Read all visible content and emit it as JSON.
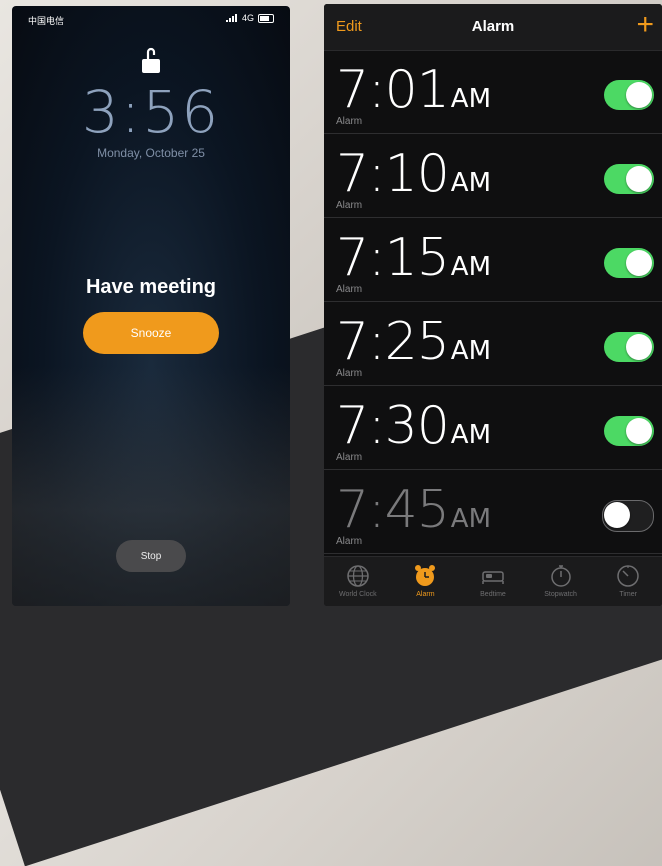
{
  "lock_screen": {
    "carrier": "中国电信",
    "network": "4G",
    "time": "3:56",
    "date": "Monday, October 25",
    "alarm_label": "Have meeting",
    "snooze_label": "Snooze",
    "stop_label": "Stop"
  },
  "alarm_app": {
    "edit_label": "Edit",
    "title": "Alarm",
    "add_label": "+",
    "accent": "#f09a1c",
    "toggle_on_color": "#4cd964",
    "alarms": [
      {
        "time": "7:01",
        "ampm": "AM",
        "label": "Alarm",
        "enabled": true
      },
      {
        "time": "7:10",
        "ampm": "AM",
        "label": "Alarm",
        "enabled": true
      },
      {
        "time": "7:15",
        "ampm": "AM",
        "label": "Alarm",
        "enabled": true
      },
      {
        "time": "7:25",
        "ampm": "AM",
        "label": "Alarm",
        "enabled": true
      },
      {
        "time": "7:30",
        "ampm": "AM",
        "label": "Alarm",
        "enabled": true
      },
      {
        "time": "7:45",
        "ampm": "AM",
        "label": "Alarm",
        "enabled": false
      }
    ],
    "tabs": [
      {
        "label": "World Clock",
        "icon": "globe-icon",
        "active": false
      },
      {
        "label": "Alarm",
        "icon": "alarm-clock-icon",
        "active": true
      },
      {
        "label": "Bedtime",
        "icon": "bed-icon",
        "active": false
      },
      {
        "label": "Stopwatch",
        "icon": "stopwatch-icon",
        "active": false
      },
      {
        "label": "Timer",
        "icon": "timer-icon",
        "active": false
      }
    ]
  }
}
